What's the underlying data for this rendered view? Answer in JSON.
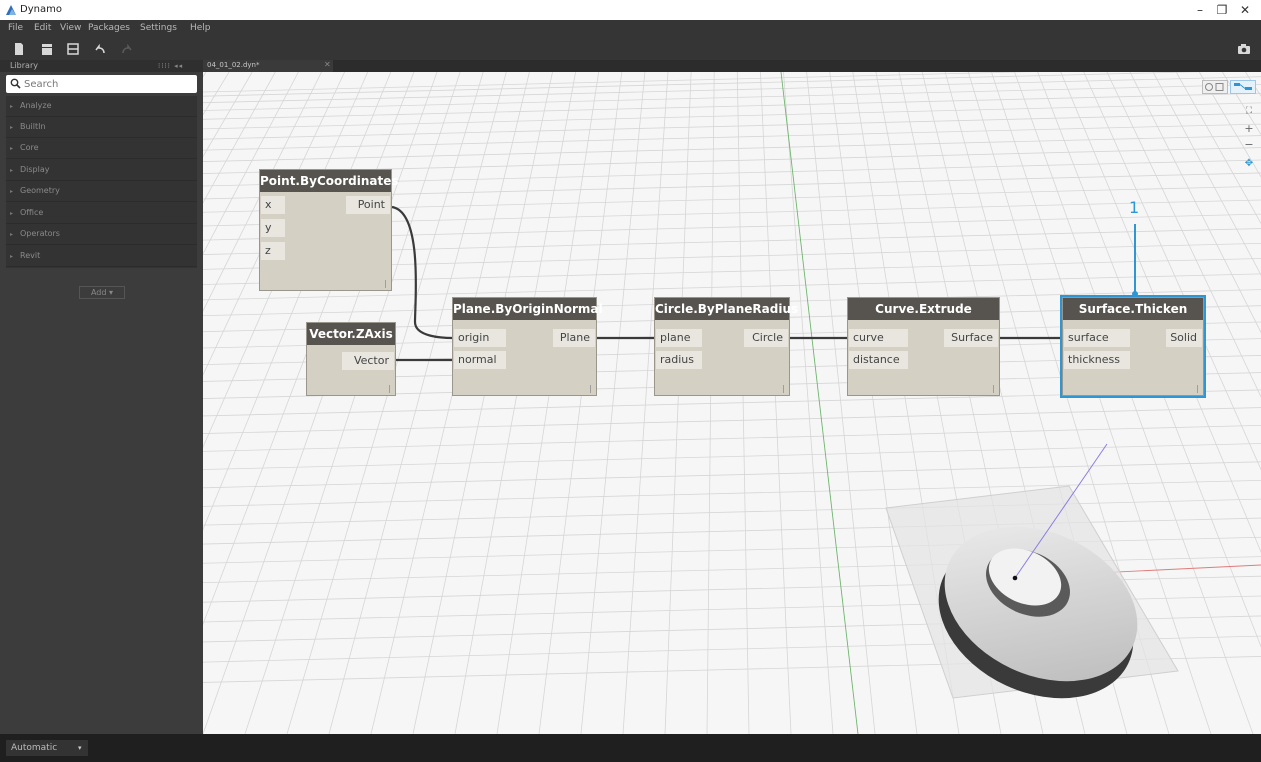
{
  "window": {
    "title": "Dynamo",
    "minimize": "–",
    "maximize": "❐",
    "close": "✕"
  },
  "menu": [
    "File",
    "Edit",
    "View",
    "Packages",
    "Settings",
    "Help"
  ],
  "library": {
    "title": "Library",
    "search_placeholder": "Search",
    "categories": [
      "Analyze",
      "BuiltIn",
      "Core",
      "Display",
      "Geometry",
      "Office",
      "Operators",
      "Revit"
    ],
    "add_label": "Add"
  },
  "tab": {
    "label": "04_01_02.dyn*",
    "close": "✕"
  },
  "nodes": {
    "point": {
      "title": "Point.ByCoordinates",
      "inputs": [
        "x",
        "y",
        "z"
      ],
      "output": "Point"
    },
    "vector": {
      "title": "Vector.ZAxis",
      "output": "Vector"
    },
    "plane": {
      "title": "Plane.ByOriginNormal",
      "inputs": [
        "origin",
        "normal"
      ],
      "output": "Plane"
    },
    "circle": {
      "title": "Circle.ByPlaneRadius",
      "inputs": [
        "plane",
        "radius"
      ],
      "output": "Circle"
    },
    "curve": {
      "title": "Curve.Extrude",
      "inputs": [
        "curve",
        "distance"
      ],
      "output": "Surface"
    },
    "surface": {
      "title": "Surface.Thicken",
      "inputs": [
        "surface",
        "thickness"
      ],
      "output": "Solid"
    },
    "lacing": "|"
  },
  "callout": {
    "label": "1"
  },
  "status": {
    "run_mode": "Automatic"
  },
  "colors": {
    "selection": "#2d97d6",
    "node_header": "#57534f",
    "node_body": "#d4d0c4",
    "canvas": "#f6f6f6",
    "wire": "#3a3a3a"
  }
}
